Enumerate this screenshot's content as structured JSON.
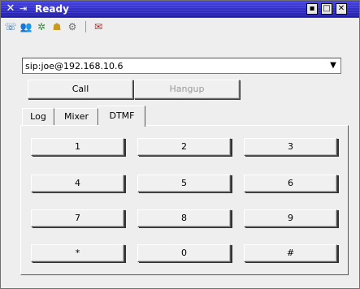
{
  "window": {
    "title": "Ready"
  },
  "toolbar": {
    "icons": [
      "phone-icon",
      "contacts-icon",
      "settings-icon",
      "profile-icon",
      "gear-icon",
      "mail-icon"
    ]
  },
  "address": {
    "value": "sip:joe@192.168.10.6"
  },
  "actions": {
    "call_label": "Call",
    "hangup_label": "Hangup"
  },
  "tabs": [
    {
      "label": "Log"
    },
    {
      "label": "Mixer"
    },
    {
      "label": "DTMF"
    }
  ],
  "keypad": {
    "keys": [
      "1",
      "2",
      "3",
      "4",
      "5",
      "6",
      "7",
      "8",
      "9",
      "*",
      "0",
      "#"
    ]
  }
}
